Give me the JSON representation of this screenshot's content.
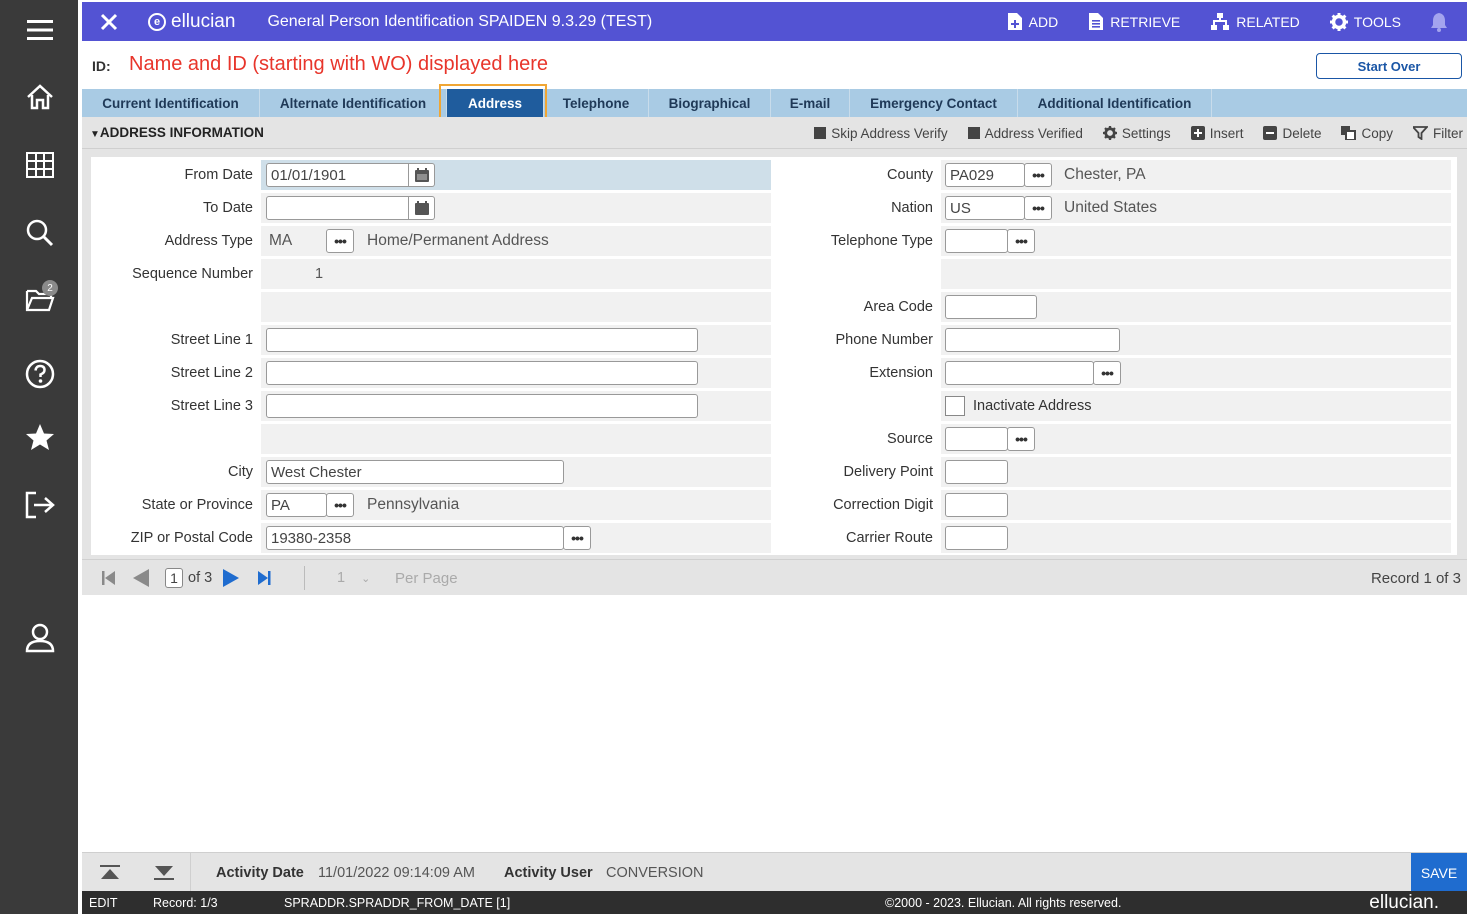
{
  "header": {
    "brand": "ellucian",
    "title": "General Person Identification SPAIDEN 9.3.29 (TEST)",
    "actions": [
      "ADD",
      "RETRIEVE",
      "RELATED",
      "TOOLS"
    ]
  },
  "sidebar": {
    "notification_count": "2"
  },
  "id_row": {
    "label": "ID:",
    "annotation": "Name and ID (starting with WO) displayed here",
    "start_over": "Start Over"
  },
  "tabs": [
    "Current Identification",
    "Alternate Identification",
    "Address",
    "Telephone",
    "Biographical",
    "E-mail",
    "Emergency Contact",
    "Additional Identification"
  ],
  "active_tab": "Address",
  "section": {
    "title": "ADDRESS INFORMATION",
    "tools": [
      "Skip Address Verify",
      "Address Verified",
      "Settings",
      "Insert",
      "Delete",
      "Copy",
      "Filter"
    ]
  },
  "form_left": {
    "from_date": {
      "label": "From Date",
      "value": "01/01/1901"
    },
    "to_date": {
      "label": "To Date",
      "value": ""
    },
    "address_type": {
      "label": "Address Type",
      "value": "MA",
      "desc": "Home/Permanent Address"
    },
    "sequence_number": {
      "label": "Sequence Number",
      "value": "1"
    },
    "street1": {
      "label": "Street Line 1",
      "value": ""
    },
    "street2": {
      "label": "Street Line 2",
      "value": ""
    },
    "street3": {
      "label": "Street Line 3",
      "value": ""
    },
    "city": {
      "label": "City",
      "value": "West Chester"
    },
    "state": {
      "label": "State or Province",
      "value": "PA",
      "desc": "Pennsylvania"
    },
    "zip": {
      "label": "ZIP or Postal Code",
      "value": "19380-2358"
    }
  },
  "form_right": {
    "county": {
      "label": "County",
      "value": "PA029",
      "desc": "Chester, PA"
    },
    "nation": {
      "label": "Nation",
      "value": "US",
      "desc": "United States"
    },
    "telephone_type": {
      "label": "Telephone Type",
      "value": ""
    },
    "area_code": {
      "label": "Area Code",
      "value": ""
    },
    "phone_number": {
      "label": "Phone Number",
      "value": ""
    },
    "extension": {
      "label": "Extension",
      "value": ""
    },
    "inactivate": {
      "label": "Inactivate Address"
    },
    "source": {
      "label": "Source",
      "value": ""
    },
    "delivery_point": {
      "label": "Delivery Point",
      "value": ""
    },
    "correction_digit": {
      "label": "Correction Digit",
      "value": ""
    },
    "carrier_route": {
      "label": "Carrier Route",
      "value": ""
    }
  },
  "pager": {
    "page": "1",
    "of_pages": "of 3",
    "per_page_value": "1",
    "per_page_label": "Per Page",
    "record_text": "Record 1 of 3"
  },
  "activity": {
    "date_label": "Activity Date",
    "date_value": "11/01/2022 09:14:09 AM",
    "user_label": "Activity User",
    "user_value": "CONVERSION",
    "save": "SAVE"
  },
  "status": {
    "mode": "EDIT",
    "record": "Record: 1/3",
    "field": "SPRADDR.SPRADDR_FROM_DATE [1]",
    "copyright": "©2000 - 2023. Ellucian. All rights reserved.",
    "logo": "ellucian."
  },
  "colors": {
    "header_bg": "#5353d3",
    "tab_bar": "#a9cbe4",
    "tab_active": "#1f5c9d",
    "highlight_box": "#f0a634",
    "annotation_text": "#e8352b",
    "save_button": "#1f6ccf",
    "sidebar_bg": "#3a3a3a"
  },
  "icons": {
    "sidebar": [
      "menu-icon",
      "home-icon",
      "grid-icon",
      "search-icon",
      "folder-icon",
      "help-icon",
      "star-icon",
      "sign-out-icon",
      "user-icon"
    ],
    "header": [
      "close-icon",
      "add-icon",
      "retrieve-icon",
      "related-icon",
      "tools-icon",
      "bell-icon"
    ]
  }
}
